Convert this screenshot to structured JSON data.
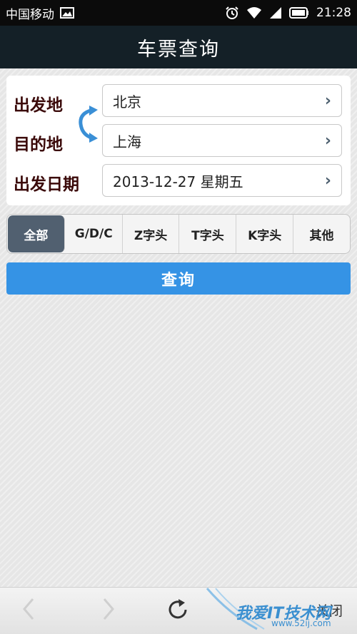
{
  "status_bar": {
    "carrier": "中国移动",
    "time": "21:28",
    "icons": [
      "image-icon",
      "alarm-icon",
      "wifi-icon",
      "signal-icon",
      "battery-icon"
    ]
  },
  "title": "车票查询",
  "form": {
    "from_label": "出发地",
    "from_value": "北京",
    "to_label": "目的地",
    "to_value": "上海",
    "date_label": "出发日期",
    "date_value": "2013-12-27 星期五",
    "chevron": "›"
  },
  "tabs": [
    {
      "label": "全部",
      "active": true
    },
    {
      "label": "G/D/C",
      "active": false
    },
    {
      "label": "Z字头",
      "active": false
    },
    {
      "label": "T字头",
      "active": false
    },
    {
      "label": "K字头",
      "active": false
    },
    {
      "label": "其他",
      "active": false
    }
  ],
  "query_button": "查询",
  "bottom_bar": {
    "close_label": "关闭",
    "icons": [
      "back-icon",
      "forward-icon",
      "refresh-icon"
    ]
  },
  "watermark": {
    "text": "我爱IT技术网",
    "url": "www.52ij.com"
  },
  "colors": {
    "title_bg": "#142027",
    "accent": "#3593e5",
    "active_tab": "#516070"
  }
}
